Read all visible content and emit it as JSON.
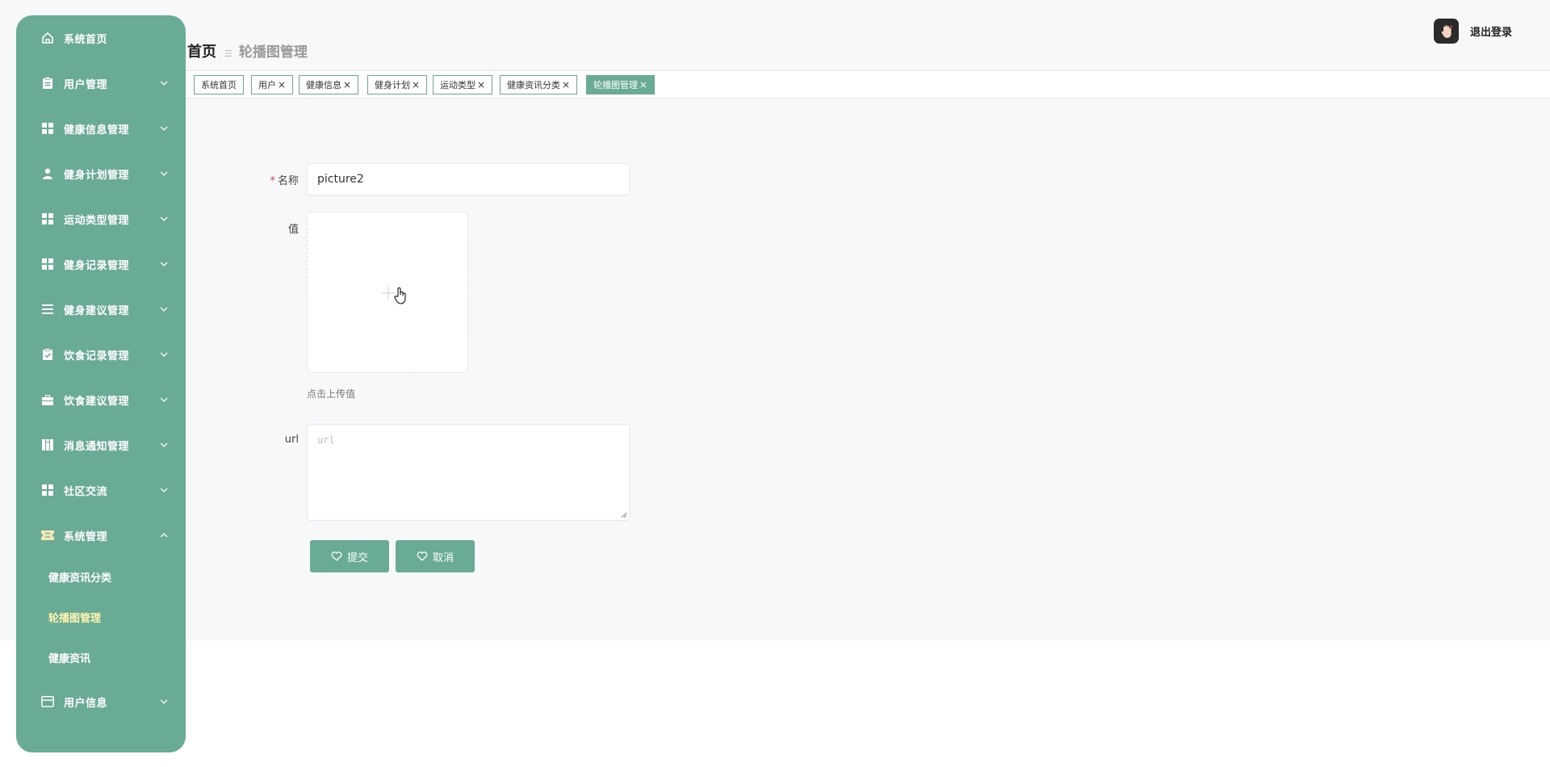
{
  "sidebar": {
    "items": [
      {
        "label": "系统首页",
        "icon": "home-icon"
      },
      {
        "label": "用户管理",
        "icon": "clipboard-icon"
      },
      {
        "label": "健康信息管理",
        "icon": "grid-icon"
      },
      {
        "label": "健身计划管理",
        "icon": "person-icon"
      },
      {
        "label": "运动类型管理",
        "icon": "grid-icon"
      },
      {
        "label": "健身记录管理",
        "icon": "grid-icon"
      },
      {
        "label": "健身建议管理",
        "icon": "list-icon"
      },
      {
        "label": "饮食记录管理",
        "icon": "clipboard-check-icon"
      },
      {
        "label": "饮食建议管理",
        "icon": "briefcase-icon"
      },
      {
        "label": "消息通知管理",
        "icon": "book-icon"
      },
      {
        "label": "社区交流",
        "icon": "grid-icon"
      },
      {
        "label": "系统管理",
        "icon": "ticket-icon"
      }
    ],
    "sub_items": [
      {
        "label": "健康资讯分类"
      },
      {
        "label": "轮播图管理"
      },
      {
        "label": "健康资讯"
      }
    ],
    "last_item": {
      "label": "用户信息",
      "icon": "card-icon"
    }
  },
  "header": {
    "breadcrumb_home": "首页",
    "breadcrumb_current": "轮播图管理",
    "logout_label": "退出登录"
  },
  "tags": [
    {
      "label": "系统首页",
      "closable": false
    },
    {
      "label": "用户",
      "closable": true
    },
    {
      "label": "健康信息",
      "closable": true
    },
    {
      "label": "健身计划",
      "closable": true
    },
    {
      "label": "运动类型",
      "closable": true
    },
    {
      "label": "健康资讯分类",
      "closable": true
    },
    {
      "label": "轮播图管理",
      "closable": true,
      "active": true
    }
  ],
  "form": {
    "name_label": "名称",
    "name_value": "picture2",
    "value_label": "值",
    "upload_tip": "点击上传值",
    "url_label": "url",
    "url_placeholder": "url",
    "submit_label": "提交",
    "cancel_label": "取消"
  },
  "colors": {
    "accent": "#6aab96",
    "active_sub": "#fff3b0",
    "required": "#e04545"
  }
}
